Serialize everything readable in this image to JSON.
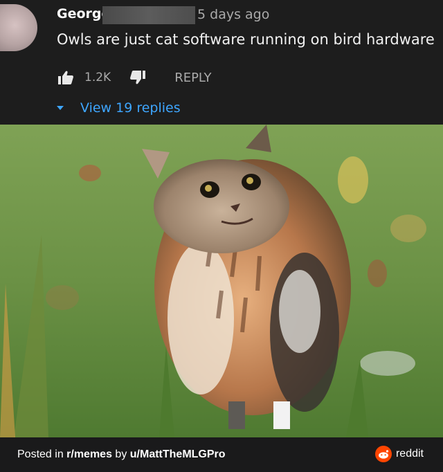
{
  "comment": {
    "author": "George",
    "time": "5 days ago",
    "text": "Owls are just cat software running on bird hardware",
    "like_count": "1.2K",
    "reply_label": "REPLY",
    "view_replies": "View 19 replies"
  },
  "footer": {
    "prefix": "Posted in ",
    "subreddit": "r/memes",
    "by": " by ",
    "user": "u/MattTheMLGPro",
    "brand": "reddit"
  },
  "colors": {
    "link_blue": "#3ea6ff",
    "muted": "#aaaaaa",
    "reddit_orange": "#ff4500"
  },
  "icons": [
    "thumbs-up-icon",
    "thumbs-down-icon",
    "caret-down-icon",
    "reddit-logo-icon"
  ]
}
